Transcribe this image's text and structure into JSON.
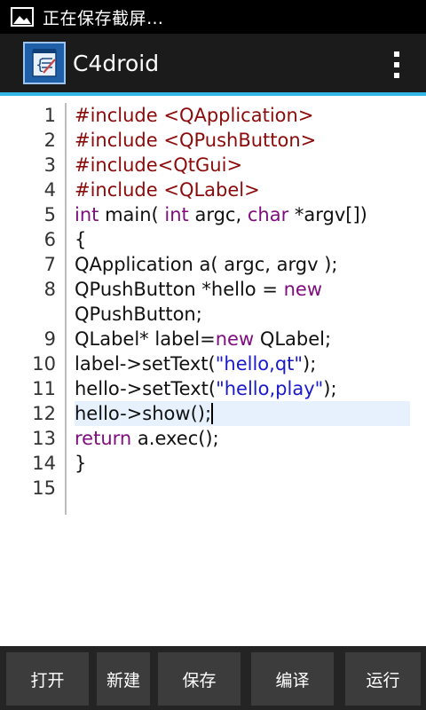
{
  "status_bar": {
    "text": "正在保存截屏…",
    "icon": "image-icon"
  },
  "action_bar": {
    "title": "C4droid",
    "app_icon": "c4droid-app-icon",
    "menu_icon": "overflow-menu-icon"
  },
  "editor": {
    "lines": [
      {
        "num": "1",
        "tokens": [
          [
            "pp",
            "#include <QApplication>"
          ]
        ]
      },
      {
        "num": "2",
        "tokens": [
          [
            "pp",
            "#include <QPushButton>"
          ]
        ]
      },
      {
        "num": "3",
        "tokens": [
          [
            "pp",
            "#include<QtGui>"
          ]
        ]
      },
      {
        "num": "4",
        "tokens": [
          [
            "pp",
            "#include <QLabel>"
          ]
        ]
      },
      {
        "num": "5",
        "tokens": [
          [
            "kw",
            "int"
          ],
          [
            "",
            " main( "
          ],
          [
            "kw",
            "int"
          ],
          [
            "",
            " argc, "
          ],
          [
            "kw",
            "char"
          ],
          [
            "",
            " *argv[])"
          ]
        ]
      },
      {
        "num": "6",
        "tokens": [
          [
            "",
            "{"
          ]
        ]
      },
      {
        "num": "7",
        "tokens": [
          [
            "",
            "QApplication a( argc, argv );"
          ]
        ]
      },
      {
        "num": "8",
        "tokens": [
          [
            "",
            "QPushButton *hello = "
          ],
          [
            "kw",
            "new"
          ]
        ]
      },
      {
        "num": "",
        "tokens": [
          [
            "",
            "QPushButton;"
          ]
        ]
      },
      {
        "num": "9",
        "tokens": [
          [
            "",
            "QLabel* label="
          ],
          [
            "kw",
            "new"
          ],
          [
            "",
            " QLabel;"
          ]
        ]
      },
      {
        "num": "10",
        "tokens": [
          [
            "",
            "label->setText("
          ],
          [
            "str",
            "\"hello,qt\""
          ],
          [
            "",
            ");"
          ]
        ]
      },
      {
        "num": "11",
        "tokens": [
          [
            "",
            "hello->setText("
          ],
          [
            "str",
            "\"hello,play\""
          ],
          [
            "",
            ");"
          ]
        ]
      },
      {
        "num": "12",
        "tokens": [
          [
            "",
            "hello->show();"
          ]
        ]
      },
      {
        "num": "13",
        "tokens": [
          [
            "kw",
            "return"
          ],
          [
            "",
            " a.exec();"
          ]
        ]
      },
      {
        "num": "14",
        "tokens": [
          [
            "",
            "}"
          ]
        ]
      },
      {
        "num": "15",
        "tokens": []
      }
    ]
  },
  "bottom_bar": {
    "open": "打开",
    "new": "新建",
    "save": "保存",
    "compile": "编译",
    "run": "运行"
  }
}
